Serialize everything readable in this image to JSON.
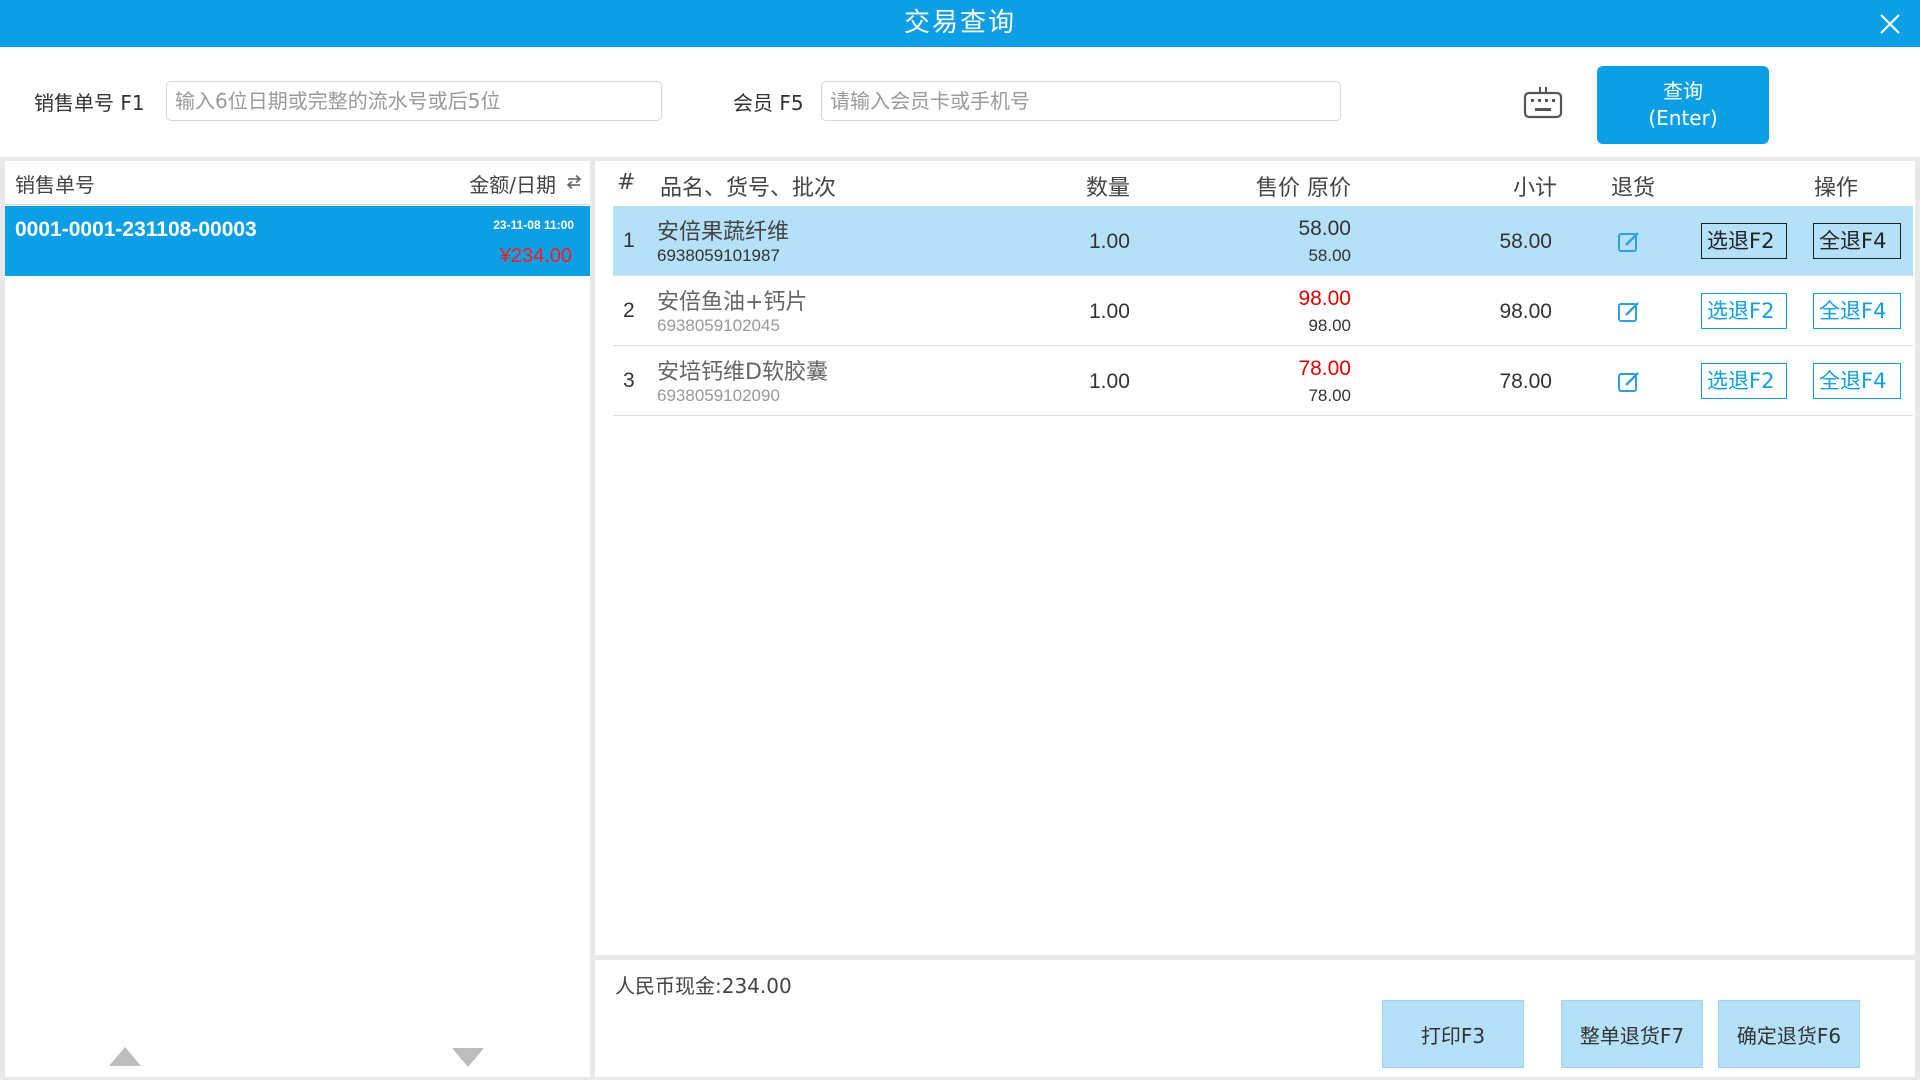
{
  "window": {
    "title": "交易查询",
    "close_icon": "close-icon"
  },
  "search": {
    "order_label": "销售单号 F1",
    "order_placeholder": "输入6位日期或完整的流水号或后5位",
    "member_label": "会员 F5",
    "member_placeholder": "请输入会员卡或手机号",
    "keyboard_icon": "keyboard-icon",
    "query_label_line1": "查询",
    "query_label_line2": "(Enter)"
  },
  "order_list": {
    "header_no": "销售单号",
    "header_amount_date": "金额/日期",
    "sort_icon": "swap-icon",
    "items": [
      {
        "no": "0001-0001-231108-00003",
        "date": "23-11-08 11:00",
        "amount": "¥234.00"
      }
    ]
  },
  "detail_table": {
    "headers": {
      "index": "#",
      "name": "品名、货号、批次",
      "qty": "数量",
      "price": "售价 原价",
      "subtotal": "小计",
      "return": "退货",
      "action": "操作"
    },
    "rows": [
      {
        "index": "1",
        "name": "安倍果蔬纤维",
        "sku": "6938059101987",
        "qty": "1.00",
        "price": "58.00",
        "original": "58.00",
        "subtotal": "58.00",
        "select_return": "选退F2",
        "full_return": "全退F4"
      },
      {
        "index": "2",
        "name": "安倍鱼油+钙片",
        "sku": "6938059102045",
        "qty": "1.00",
        "price": "98.00",
        "original": "98.00",
        "subtotal": "98.00",
        "select_return": "选退F2",
        "full_return": "全退F4"
      },
      {
        "index": "3",
        "name": "安培钙维D软胶囊",
        "sku": "6938059102090",
        "qty": "1.00",
        "price": "78.00",
        "original": "78.00",
        "subtotal": "78.00",
        "select_return": "选退F2",
        "full_return": "全退F4"
      }
    ],
    "edit_icon": "edit-icon"
  },
  "footer": {
    "payment": "人民币现金:234.00",
    "print_label": "打印F3",
    "whole_return_label": "整单退货F7",
    "confirm_return_label": "确定退货F6"
  },
  "colors": {
    "accent": "#0d9fe5",
    "selected_row": "#b4e1f7",
    "price_red": "#e00000"
  }
}
